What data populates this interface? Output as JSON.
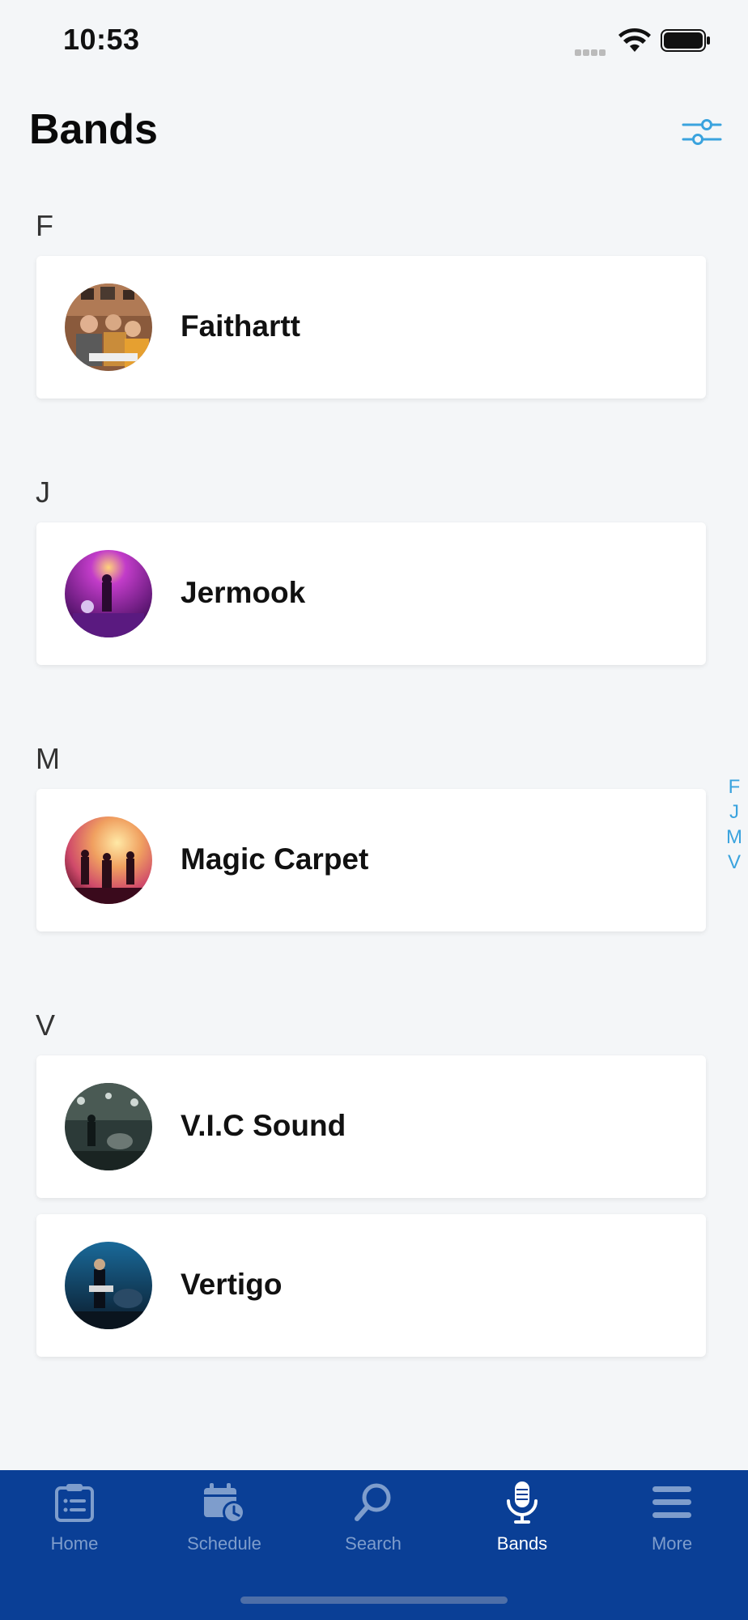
{
  "status_bar": {
    "time": "10:53"
  },
  "header": {
    "title": "Bands",
    "filter_icon": "sliders-icon"
  },
  "sections": [
    {
      "letter": "F",
      "bands": [
        {
          "name": "Faithartt"
        }
      ]
    },
    {
      "letter": "J",
      "bands": [
        {
          "name": "Jermook"
        }
      ]
    },
    {
      "letter": "M",
      "bands": [
        {
          "name": "Magic Carpet"
        }
      ]
    },
    {
      "letter": "V",
      "bands": [
        {
          "name": "V.I.C Sound"
        },
        {
          "name": "Vertigo"
        }
      ]
    }
  ],
  "index": [
    "F",
    "J",
    "M",
    "V"
  ],
  "tab_bar": {
    "items": [
      {
        "label": "Home",
        "icon": "clipboard-list-icon"
      },
      {
        "label": "Schedule",
        "icon": "calendar-clock-icon"
      },
      {
        "label": "Search",
        "icon": "search-icon"
      },
      {
        "label": "Bands",
        "icon": "microphone-icon",
        "active": true
      },
      {
        "label": "More",
        "icon": "menu-icon"
      }
    ]
  },
  "colors": {
    "accent": "#3aa3de",
    "tab_bar": "#0a3f96",
    "tab_inactive": "#7e9dcc",
    "background": "#f4f6f8"
  }
}
